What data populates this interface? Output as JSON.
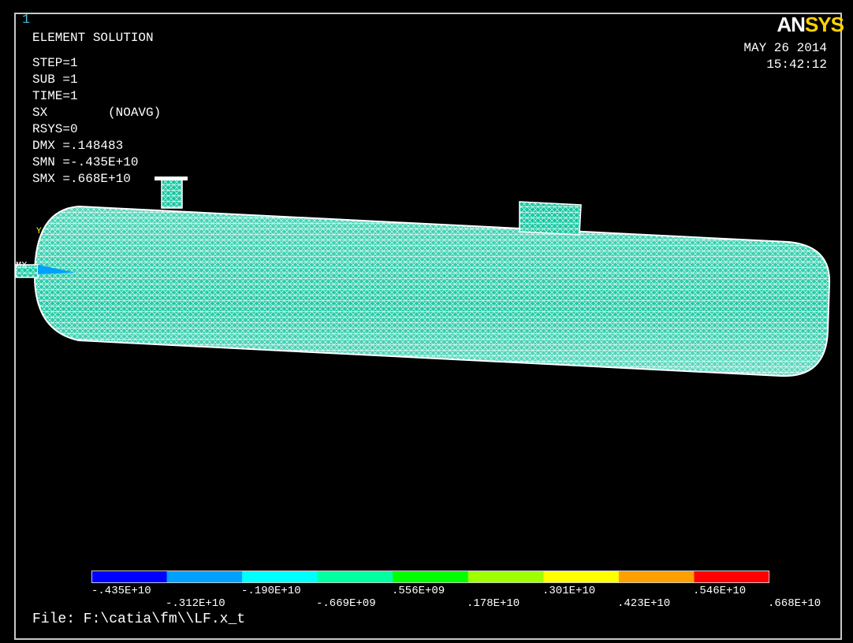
{
  "viewport": {
    "number": "1"
  },
  "header": {
    "title": "ELEMENT SOLUTION",
    "lines": [
      "STEP=1",
      "SUB =1",
      "TIME=1",
      "SX        (NOAVG)",
      "RSYS=0",
      "DMX =.148483",
      "SMN =-.435E+10",
      "SMX =.668E+10"
    ]
  },
  "logo": {
    "part1": "AN",
    "part2": "SYS"
  },
  "datetime": {
    "date": "MAY 26 2014",
    "time": "15:42:12"
  },
  "model": {
    "marker_label": "MX",
    "axis_label": "Y"
  },
  "legend": {
    "colors": [
      "#0000ff",
      "#00a0ff",
      "#00ffff",
      "#00ffa0",
      "#00ff00",
      "#a0ff00",
      "#ffff00",
      "#ffa000",
      "#ff0000"
    ],
    "labels_top": [
      "-.435E+10",
      "-.190E+10",
      ".556E+09",
      ".301E+10",
      ".546E+10"
    ],
    "labels_bottom": [
      "-.312E+10",
      "-.669E+09",
      ".178E+10",
      ".423E+10",
      ".668E+10"
    ]
  },
  "footer": {
    "file": "File: F:\\catia\\fm\\\\LF.x_t"
  }
}
